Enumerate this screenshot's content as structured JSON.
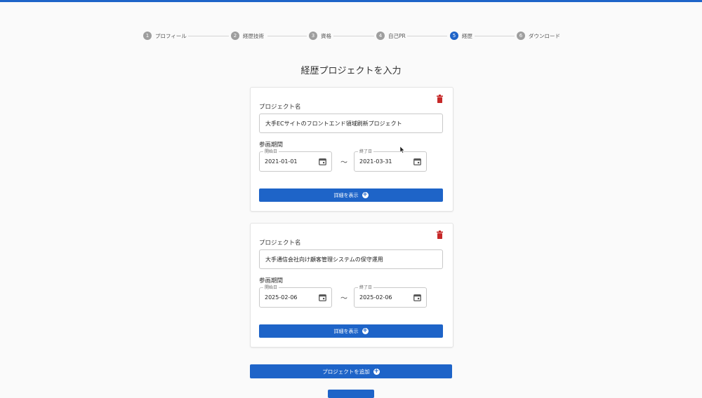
{
  "stepper": {
    "steps": [
      {
        "num": "1",
        "label": "プロフィール"
      },
      {
        "num": "2",
        "label": "経歴技術"
      },
      {
        "num": "3",
        "label": "資格"
      },
      {
        "num": "4",
        "label": "自己PR"
      },
      {
        "num": "5",
        "label": "経歴"
      },
      {
        "num": "6",
        "label": "ダウンロード"
      }
    ],
    "active_index": 4
  },
  "page": {
    "title": "経歴プロジェクトを入力"
  },
  "projects": [
    {
      "name_label": "プロジェクト名",
      "name": "大手ECサイトのフロントエンド領域刷新プロジェクト",
      "period_label": "参画期間",
      "start_label": "開始日",
      "start": "2021-01-01",
      "separator": "〜",
      "end_label": "終了日",
      "end": "2021-03-31",
      "detail_button": "詳細を表示"
    },
    {
      "name_label": "プロジェクト名",
      "name": "大手通信会社向け顧客管理システムの保守運用",
      "period_label": "参画期間",
      "start_label": "開始日",
      "start": "2025-02-06",
      "separator": "〜",
      "end_label": "終了日",
      "end": "2025-02-06",
      "detail_button": "詳細を表示"
    }
  ],
  "add_button": "プロジェクトを追加",
  "icons": {
    "delete": "trash-icon",
    "calendar": "calendar-icon",
    "add": "plus-circle-icon"
  },
  "colors": {
    "accent": "#1e64c8",
    "delete": "#c62828",
    "inactive_step": "#9e9e9e"
  }
}
